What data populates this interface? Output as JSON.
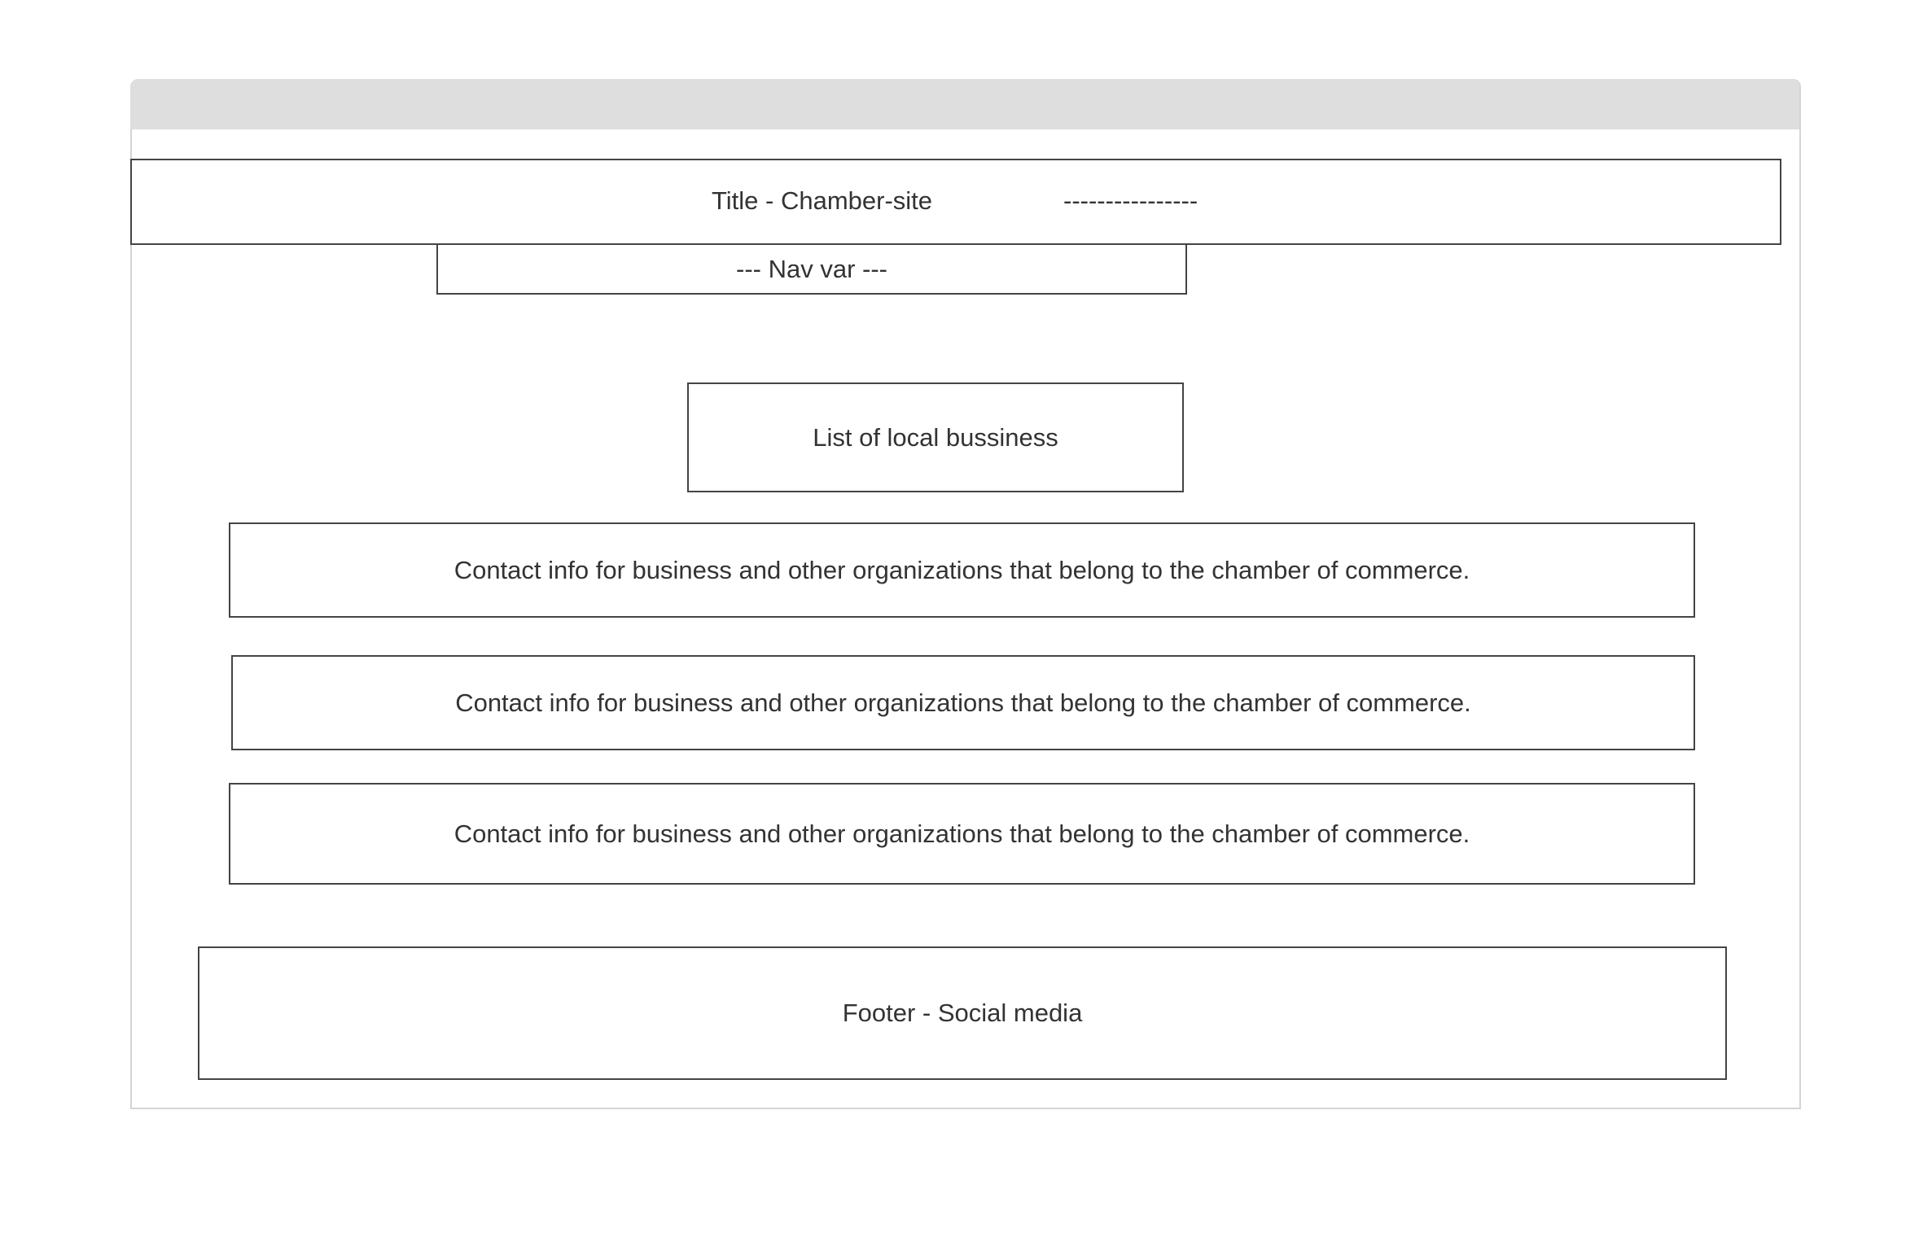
{
  "header": {
    "title": "Title - Chamber-site",
    "placeholder_dashes": "----------------"
  },
  "nav": {
    "label": "--- Nav var ---"
  },
  "main": {
    "list_heading": "List of local bussiness",
    "contacts": [
      "Contact info for business and other organizations that belong to the chamber of commerce.",
      "Contact info for business and other organizations that belong to the chamber of commerce.",
      "Contact info for business and other organizations that belong to the chamber of commerce."
    ]
  },
  "footer": {
    "label": "Footer - Social media"
  }
}
